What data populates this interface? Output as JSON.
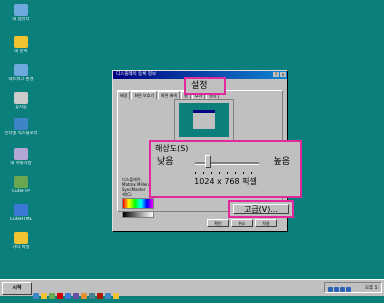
{
  "desktop_icons": [
    {
      "label": "내 컴퓨터",
      "name": "my-computer-icon",
      "color": "#6fa8dc"
    },
    {
      "label": "내 문서",
      "name": "my-documents-icon",
      "color": "#f1c232"
    },
    {
      "label": "네트워크 환경",
      "name": "network-icon",
      "color": "#6fa8dc"
    },
    {
      "label": "휴지통",
      "name": "recycle-bin-icon",
      "color": "#cccccc"
    },
    {
      "label": "인터넷 익스플로러",
      "name": "internet-explorer-icon",
      "color": "#3d85c6"
    },
    {
      "label": "내 서류가방",
      "name": "briefcase-icon",
      "color": "#b4a7d6"
    },
    {
      "label": "CuteFTP",
      "name": "cuteftp-icon",
      "color": "#6aa84f"
    },
    {
      "label": "CuteHTML",
      "name": "cutehtml-icon",
      "color": "#3c78d8"
    },
    {
      "label": "기타 파일",
      "name": "folder-icon",
      "color": "#f1c232"
    }
  ],
  "dialog": {
    "title": "디스플레이 등록 정보",
    "tabs": [
      "배경",
      "화면 보호기",
      "화면 배색",
      "웹",
      "효과",
      "설정"
    ],
    "info_lines": [
      "디스플레이:",
      "Matrox Millen",
      "SyncMaster",
      "색(C)"
    ],
    "buttons": {
      "properties": "등록 정보",
      "ok": "확인",
      "cancel": "취소",
      "apply": "적용"
    }
  },
  "callouts": {
    "settings_tab": "설정",
    "resolution_label": "해상도(S)",
    "low": "낮음",
    "high": "높음",
    "resolution_value": "1024 x 768 픽셀",
    "advanced_button": "고급(V)...",
    "slider_position": 0.2,
    "accent_color": "#e0299a"
  },
  "taskbar": {
    "start_label": "시작",
    "tray_text": "오후 5:"
  }
}
